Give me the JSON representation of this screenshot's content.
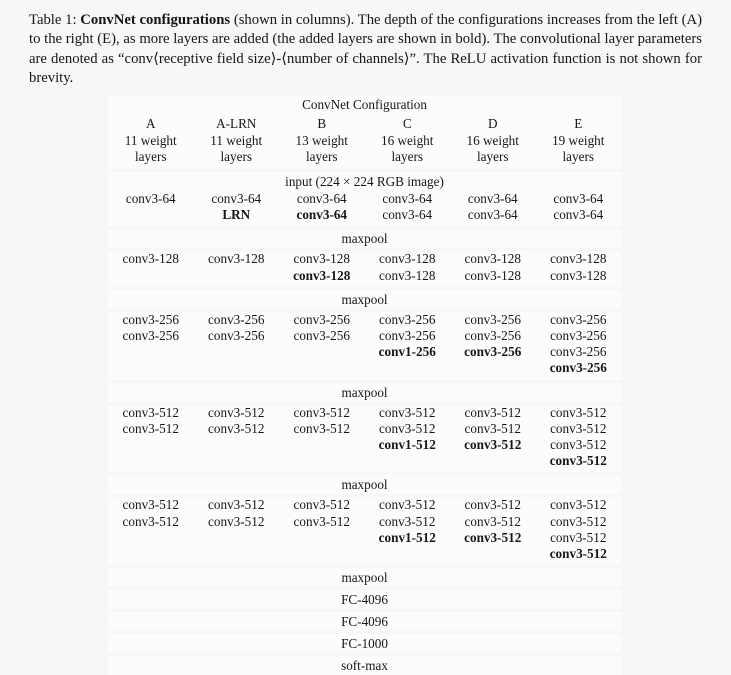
{
  "caption": {
    "label": "Table 1:",
    "bold_title": "ConvNet configurations",
    "text_1": " (shown in columns). The depth of the configurations increases from the left (A) to the right (E), as more layers are added (the added layers are shown in bold). The convolutional layer parameters are denoted as “conv⟨receptive field size⟩-⟨number of channels⟩”. The ReLU activation function is not shown for brevity."
  },
  "table": {
    "title_row": "ConvNet Configuration",
    "columns": [
      "A",
      "A-LRN",
      "B",
      "C",
      "D",
      "E"
    ],
    "weight_layers": [
      "11 weight\nlayers",
      "11 weight\nlayers",
      "13 weight\nlayers",
      "16 weight\nlayers",
      "16 weight\nlayers",
      "19 weight\nlayers"
    ],
    "weight_layers_lines": [
      [
        "11 weight",
        "layers"
      ],
      [
        "11 weight",
        "layers"
      ],
      [
        "13 weight",
        "layers"
      ],
      [
        "16 weight",
        "layers"
      ],
      [
        "16 weight",
        "layers"
      ],
      [
        "19 weight",
        "layers"
      ]
    ],
    "input_row": "input (224 × 224 RGB image)",
    "maxpool_label": "maxpool",
    "blocks": [
      {
        "id": "block-64",
        "slots": 2,
        "cells": [
          [
            {
              "text": "conv3-64",
              "bold": false
            }
          ],
          [
            {
              "text": "conv3-64",
              "bold": false
            },
            {
              "text": "LRN",
              "bold": true
            }
          ],
          [
            {
              "text": "conv3-64",
              "bold": false
            },
            {
              "text": "conv3-64",
              "bold": true
            }
          ],
          [
            {
              "text": "conv3-64",
              "bold": false
            },
            {
              "text": "conv3-64",
              "bold": false
            }
          ],
          [
            {
              "text": "conv3-64",
              "bold": false
            },
            {
              "text": "conv3-64",
              "bold": false
            }
          ],
          [
            {
              "text": "conv3-64",
              "bold": false
            },
            {
              "text": "conv3-64",
              "bold": false
            }
          ]
        ]
      },
      {
        "id": "block-128",
        "slots": 2,
        "cells": [
          [
            {
              "text": "conv3-128",
              "bold": false
            }
          ],
          [
            {
              "text": "conv3-128",
              "bold": false
            }
          ],
          [
            {
              "text": "conv3-128",
              "bold": false
            },
            {
              "text": "conv3-128",
              "bold": true
            }
          ],
          [
            {
              "text": "conv3-128",
              "bold": false
            },
            {
              "text": "conv3-128",
              "bold": false
            }
          ],
          [
            {
              "text": "conv3-128",
              "bold": false
            },
            {
              "text": "conv3-128",
              "bold": false
            }
          ],
          [
            {
              "text": "conv3-128",
              "bold": false
            },
            {
              "text": "conv3-128",
              "bold": false
            }
          ]
        ]
      },
      {
        "id": "block-256",
        "slots": 4,
        "cells": [
          [
            {
              "text": "conv3-256",
              "bold": false
            },
            {
              "text": "conv3-256",
              "bold": false
            }
          ],
          [
            {
              "text": "conv3-256",
              "bold": false
            },
            {
              "text": "conv3-256",
              "bold": false
            }
          ],
          [
            {
              "text": "conv3-256",
              "bold": false
            },
            {
              "text": "conv3-256",
              "bold": false
            }
          ],
          [
            {
              "text": "conv3-256",
              "bold": false
            },
            {
              "text": "conv3-256",
              "bold": false
            },
            {
              "text": "conv1-256",
              "bold": true
            }
          ],
          [
            {
              "text": "conv3-256",
              "bold": false
            },
            {
              "text": "conv3-256",
              "bold": false
            },
            {
              "text": "conv3-256",
              "bold": true
            }
          ],
          [
            {
              "text": "conv3-256",
              "bold": false
            },
            {
              "text": "conv3-256",
              "bold": false
            },
            {
              "text": "conv3-256",
              "bold": false
            },
            {
              "text": "conv3-256",
              "bold": true
            }
          ]
        ]
      },
      {
        "id": "block-512a",
        "slots": 4,
        "cells": [
          [
            {
              "text": "conv3-512",
              "bold": false
            },
            {
              "text": "conv3-512",
              "bold": false
            }
          ],
          [
            {
              "text": "conv3-512",
              "bold": false
            },
            {
              "text": "conv3-512",
              "bold": false
            }
          ],
          [
            {
              "text": "conv3-512",
              "bold": false
            },
            {
              "text": "conv3-512",
              "bold": false
            }
          ],
          [
            {
              "text": "conv3-512",
              "bold": false
            },
            {
              "text": "conv3-512",
              "bold": false
            },
            {
              "text": "conv1-512",
              "bold": true
            }
          ],
          [
            {
              "text": "conv3-512",
              "bold": false
            },
            {
              "text": "conv3-512",
              "bold": false
            },
            {
              "text": "conv3-512",
              "bold": true
            }
          ],
          [
            {
              "text": "conv3-512",
              "bold": false
            },
            {
              "text": "conv3-512",
              "bold": false
            },
            {
              "text": "conv3-512",
              "bold": false
            },
            {
              "text": "conv3-512",
              "bold": true
            }
          ]
        ]
      },
      {
        "id": "block-512b",
        "slots": 4,
        "cells": [
          [
            {
              "text": "conv3-512",
              "bold": false
            },
            {
              "text": "conv3-512",
              "bold": false
            }
          ],
          [
            {
              "text": "conv3-512",
              "bold": false
            },
            {
              "text": "conv3-512",
              "bold": false
            }
          ],
          [
            {
              "text": "conv3-512",
              "bold": false
            },
            {
              "text": "conv3-512",
              "bold": false
            }
          ],
          [
            {
              "text": "conv3-512",
              "bold": false
            },
            {
              "text": "conv3-512",
              "bold": false
            },
            {
              "text": "conv1-512",
              "bold": true
            }
          ],
          [
            {
              "text": "conv3-512",
              "bold": false
            },
            {
              "text": "conv3-512",
              "bold": false
            },
            {
              "text": "conv3-512",
              "bold": true
            }
          ],
          [
            {
              "text": "conv3-512",
              "bold": false
            },
            {
              "text": "conv3-512",
              "bold": false
            },
            {
              "text": "conv3-512",
              "bold": false
            },
            {
              "text": "conv3-512",
              "bold": true
            }
          ]
        ]
      }
    ],
    "footer_rows": [
      "maxpool",
      "FC-4096",
      "FC-4096",
      "FC-1000",
      "soft-max"
    ]
  }
}
